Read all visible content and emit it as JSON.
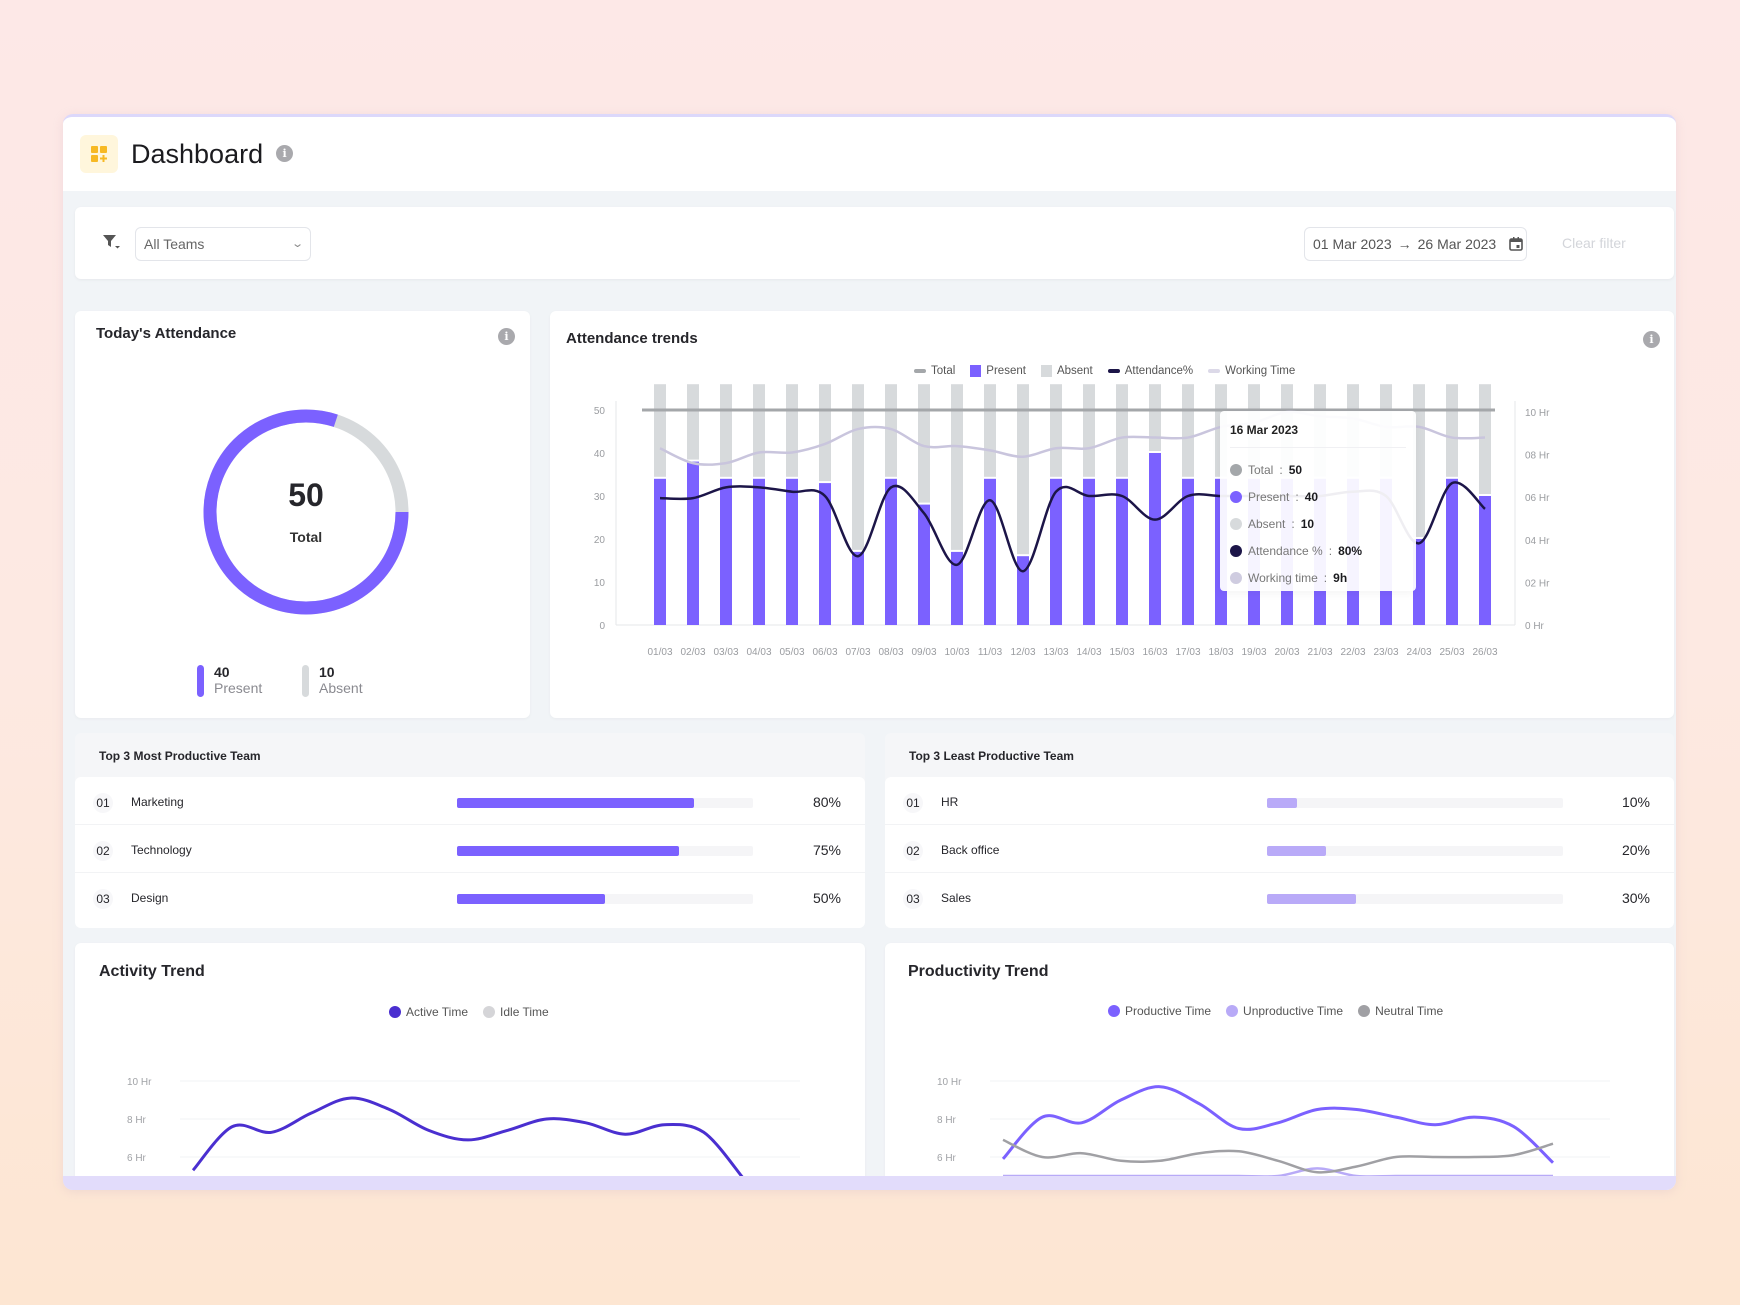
{
  "header": {
    "title": "Dashboard",
    "app_icon": "dashboard-grid-icon",
    "info_icon": "info-icon"
  },
  "filters": {
    "filter_icon": "filter-icon",
    "team_select": {
      "value": "All Teams",
      "icon": "chevron-down-icon"
    },
    "date_range": {
      "start": "01 Mar 2023",
      "arrow": "→",
      "end": "26 Mar 2023",
      "icon": "calendar-icon"
    },
    "clear_label": "Clear filter"
  },
  "colors": {
    "present": "#7b61ff",
    "absent": "#d7dadc",
    "total": "#a4a7aa",
    "attendance_pct": "#1c1548",
    "working_time": "#c9c5dd",
    "active": "#4a2fd0",
    "productive": "#7b61ff",
    "unproductive": "#b8aaf7",
    "neutral": "#a0a0a4",
    "bar_light": "#b9aaf8"
  },
  "todays_attendance": {
    "title": "Today's Attendance",
    "total": 50,
    "total_label": "Total",
    "present": {
      "value": 40,
      "label": "Present"
    },
    "absent": {
      "value": 10,
      "label": "Absent"
    }
  },
  "attendance_trends": {
    "title": "Attendance trends",
    "legend": [
      "Total",
      "Present",
      "Absent",
      "Attendance%",
      "Working Time"
    ],
    "tooltip": {
      "date": "16 Mar 2023",
      "rows": [
        {
          "label": "Total",
          "value": "50"
        },
        {
          "label": "Present",
          "value": "40"
        },
        {
          "label": "Absent",
          "value": "10"
        },
        {
          "label": "Attendance %",
          "value": "80%"
        },
        {
          "label": "Working time",
          "value": "9h"
        }
      ]
    }
  },
  "chart_data": [
    {
      "type": "bar",
      "title": "Attendance trends",
      "categories": [
        "01/03",
        "02/03",
        "03/03",
        "04/03",
        "05/03",
        "06/03",
        "07/03",
        "08/03",
        "09/03",
        "10/03",
        "11/03",
        "12/03",
        "13/03",
        "14/03",
        "15/03",
        "16/03",
        "17/03",
        "18/03",
        "19/03",
        "20/03",
        "21/03",
        "22/03",
        "23/03",
        "24/03",
        "25/03",
        "26/03"
      ],
      "yticks": [
        "0",
        "10",
        "20",
        "30",
        "40",
        "50"
      ],
      "ylim": [
        0,
        50
      ],
      "y2ticks": [
        "0 Hr",
        "02 Hr",
        "04 Hr",
        "06 Hr",
        "08 Hr",
        "10 Hr"
      ],
      "y2lim": [
        0,
        10
      ],
      "series": [
        {
          "name": "Present",
          "kind": "bar-stacked",
          "values": [
            34,
            38,
            34,
            34,
            34,
            33,
            17,
            34,
            28,
            17,
            34,
            16,
            34,
            34,
            34,
            40,
            34,
            34,
            34,
            34,
            34,
            34,
            34,
            20,
            34,
            30
          ]
        },
        {
          "name": "Absent",
          "kind": "bar-stacked",
          "values": [
            22,
            18,
            22,
            22,
            22,
            23,
            39,
            22,
            28,
            39,
            22,
            40,
            22,
            22,
            22,
            16,
            22,
            22,
            22,
            22,
            22,
            22,
            22,
            36,
            22,
            26
          ]
        },
        {
          "name": "Total",
          "kind": "line",
          "values": [
            50,
            50,
            50,
            50,
            50,
            50,
            50,
            50,
            50,
            50,
            50,
            50,
            50,
            50,
            50,
            50,
            50,
            50,
            50,
            50,
            50,
            50,
            50,
            50,
            50,
            50
          ]
        },
        {
          "name": "Attendance%",
          "kind": "line",
          "values": [
            29.5,
            29.5,
            32,
            32,
            31,
            30,
            16,
            32,
            26,
            14,
            29,
            12.5,
            31,
            30,
            30,
            24.5,
            30,
            30,
            30,
            30,
            30,
            31,
            30,
            19,
            33,
            27
          ]
        },
        {
          "name": "Working Time",
          "kind": "line",
          "axis": "right",
          "values": [
            8.3,
            7.6,
            7.6,
            8.1,
            8.1,
            8.5,
            9.2,
            9.2,
            8.4,
            8.4,
            8.2,
            7.9,
            8.3,
            8.3,
            8.8,
            8.8,
            8.8,
            9.3,
            9.5,
            10.0,
            9.8,
            9.7,
            9.3,
            9.3,
            8.8,
            8.8
          ]
        }
      ],
      "legend_position": "top-center"
    },
    {
      "type": "line",
      "title": "Activity Trend",
      "yticks": [
        "6 Hr",
        "8 Hr",
        "10 Hr"
      ],
      "ylim": [
        5,
        10
      ],
      "series": [
        {
          "name": "Active Time",
          "values": [
            5.3,
            7.6,
            7.3,
            8.3,
            9.1,
            8.5,
            7.4,
            6.9,
            7.4,
            8.0,
            7.8,
            7.2,
            7.7,
            7.3,
            4.9
          ]
        },
        {
          "name": "Idle Time",
          "values": []
        }
      ],
      "legend_position": "top-center"
    },
    {
      "type": "line",
      "title": "Productivity Trend",
      "yticks": [
        "6 Hr",
        "8 Hr",
        "10 Hr"
      ],
      "ylim": [
        5,
        10
      ],
      "series": [
        {
          "name": "Productive Time",
          "values": [
            5.9,
            8.1,
            7.8,
            9.0,
            9.7,
            8.8,
            7.5,
            7.8,
            8.5,
            8.5,
            8.1,
            7.7,
            8.1,
            7.6,
            5.7
          ]
        },
        {
          "name": "Unproductive Time",
          "values": [
            5.0,
            5.0,
            5.0,
            5.0,
            5.0,
            5.0,
            5.0,
            5.0,
            5.4,
            5.0,
            5.0,
            5.0,
            5.0,
            5.0,
            5.0
          ]
        },
        {
          "name": "Neutral Time",
          "values": [
            6.9,
            6.0,
            6.2,
            5.8,
            5.8,
            6.2,
            6.3,
            5.8,
            5.2,
            5.5,
            6.0,
            6.0,
            6.0,
            6.1,
            6.7
          ]
        }
      ],
      "legend_position": "top-center"
    }
  ],
  "most_productive": {
    "title": "Top 3 Most Productive Team",
    "rows": [
      {
        "rank": "01",
        "name": "Marketing",
        "percent": 80,
        "label": "80%"
      },
      {
        "rank": "02",
        "name": "Technology",
        "percent": 75,
        "label": "75%"
      },
      {
        "rank": "03",
        "name": "Design",
        "percent": 50,
        "label": "50%"
      }
    ]
  },
  "least_productive": {
    "title": "Top 3 Least Productive Team",
    "rows": [
      {
        "rank": "01",
        "name": "HR",
        "percent": 10,
        "label": "10%"
      },
      {
        "rank": "02",
        "name": "Back office",
        "percent": 20,
        "label": "20%"
      },
      {
        "rank": "03",
        "name": "Sales",
        "percent": 30,
        "label": "30%"
      }
    ]
  },
  "activity_trend": {
    "title": "Activity Trend",
    "legend": [
      "Active Time",
      "Idle Time"
    ]
  },
  "productivity_trend": {
    "title": "Productivity Trend",
    "legend": [
      "Productive Time",
      "Unproductive Time",
      "Neutral Time"
    ]
  }
}
